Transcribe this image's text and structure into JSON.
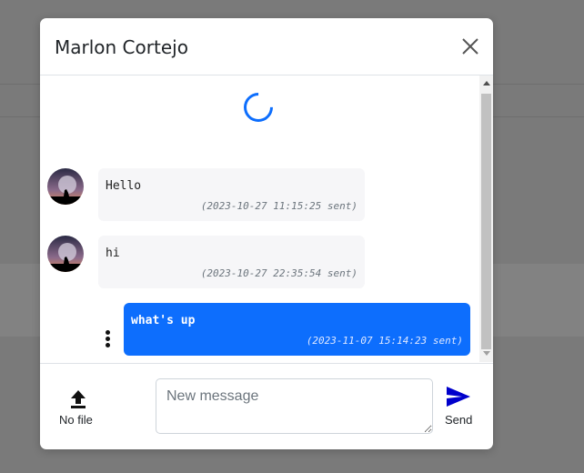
{
  "modal": {
    "title": "Marlon Cortejo"
  },
  "messages": [
    {
      "direction": "incoming",
      "text": "Hello",
      "time": "(2023-10-27 11:15:25 sent)"
    },
    {
      "direction": "incoming",
      "text": "hi",
      "time": "(2023-10-27 22:35:54 sent)"
    },
    {
      "direction": "outgoing",
      "text": "what's up",
      "time": "(2023-11-07 15:14:23 sent)"
    }
  ],
  "footer": {
    "upload_label": "No file",
    "input_placeholder": "New message",
    "send_label": "Send"
  },
  "colors": {
    "accent": "#0d6efd",
    "incoming_bubble": "#f6f6f8",
    "send_icon": "#0000cc"
  },
  "icons": {
    "close": "close-icon",
    "upload": "upload-icon",
    "send": "send-icon",
    "menu": "kebab-icon"
  }
}
